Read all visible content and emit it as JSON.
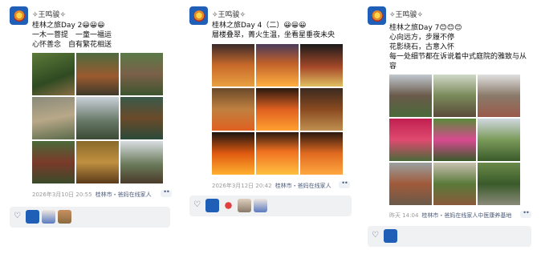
{
  "posts": [
    {
      "username": "✧王鸣骏✧",
      "lines": [
        "桂林之旅Day 2😀😀😀",
        "一木一菩提　一童一福运",
        "心怀善念　自有繁花相送"
      ],
      "date": "2026年3月10日 20:55",
      "location": "桂林市・爸妈在线家人",
      "more": "••"
    },
    {
      "username": "✧王鸣骏✧",
      "lines": [
        "桂林之旅Day 4（二）😀😀😀",
        "層楼叠翠，菁火生温，坐看星垂夜未央"
      ],
      "date": "2026年3月12日 20:42",
      "location": "桂林市・爸妈在线家人",
      "more": "••"
    },
    {
      "username": "✧王鸣骏✧",
      "lines": [
        "桂林之旅Day 7😊😊😊",
        "心向远方，步履不停",
        "花影绕石，古意入怀",
        "每一处细节都在诉说着中式庭院的雅致与从",
        "容"
      ],
      "date": "昨天 14:04",
      "location": "桂林市・爸妈在线家人中医康养基地",
      "more": "••"
    }
  ],
  "icons": {
    "like": "heart-icon",
    "more": "more-icon",
    "avatar": "phoenix-avatar-icon"
  },
  "colors": {
    "avatar_bg": "#1f5fb8",
    "link": "#4a5a7a",
    "meta": "#9a9a9a",
    "likes_bg": "#f0f1f3"
  }
}
